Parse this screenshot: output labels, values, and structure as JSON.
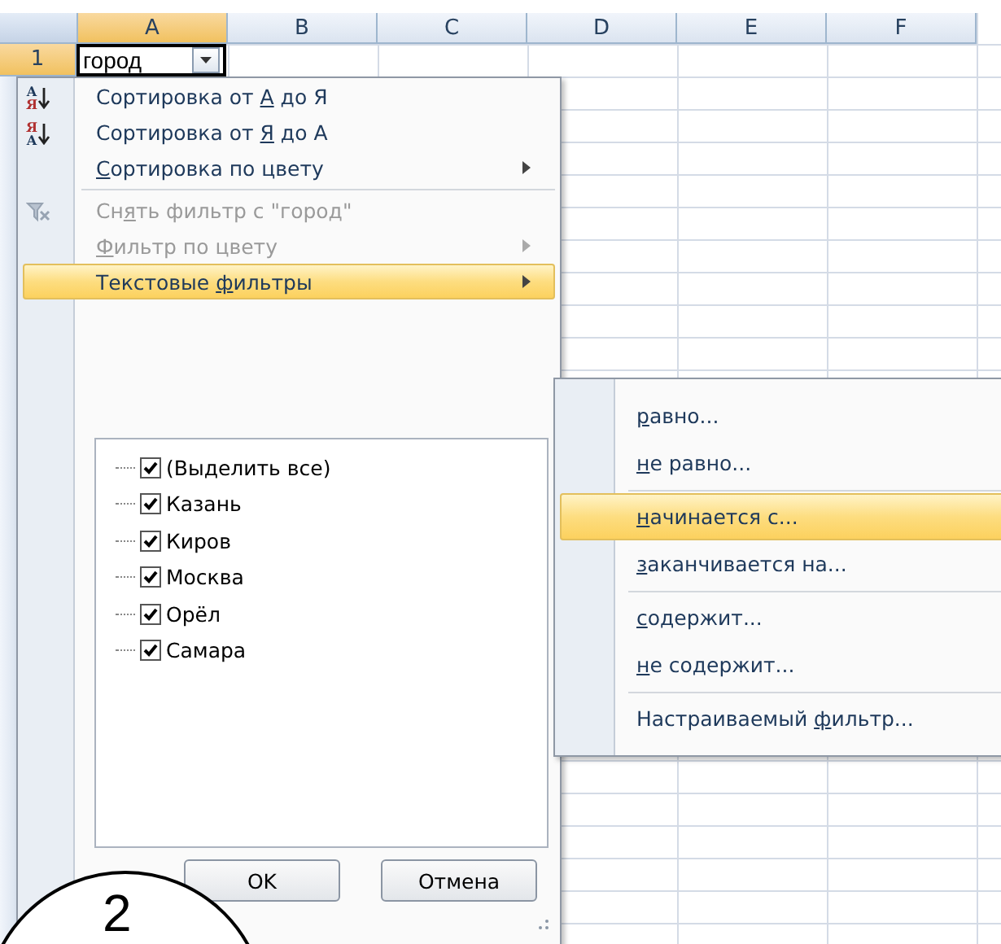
{
  "sheet": {
    "columns": [
      {
        "label": "A",
        "selected": true
      },
      {
        "label": "B",
        "selected": false
      },
      {
        "label": "C",
        "selected": false
      },
      {
        "label": "D",
        "selected": false
      },
      {
        "label": "E",
        "selected": false
      },
      {
        "label": "F",
        "selected": false
      }
    ],
    "rows": [
      {
        "number": "1",
        "selected": true,
        "cell": "город"
      }
    ]
  },
  "filter_menu": {
    "items": [
      {
        "kind": "sort_asc",
        "icon_text": [
          "А",
          "Я"
        ],
        "before": "Сортировка от ",
        "key": "А",
        "after": " до Я",
        "disabled": false,
        "submenu": false,
        "highlighted": false
      },
      {
        "kind": "sort_desc",
        "icon_text": [
          "Я",
          "А"
        ],
        "before": "Сортировка от ",
        "key": "Я",
        "after": " до А",
        "disabled": false,
        "submenu": false,
        "highlighted": false
      },
      {
        "kind": "item",
        "key": "С",
        "after": "ортировка по цвету",
        "disabled": false,
        "submenu": true,
        "highlighted": false
      },
      {
        "kind": "separator"
      },
      {
        "kind": "clear_filter",
        "before": "Сн",
        "key": "я",
        "after": "ть фильтр с \"город\"",
        "disabled": true,
        "submenu": false,
        "highlighted": false
      },
      {
        "kind": "item",
        "key": "Ф",
        "after": "ильтр по цвету",
        "disabled": true,
        "submenu": true,
        "highlighted": false
      },
      {
        "kind": "item",
        "before": "Текстовые ",
        "key": "ф",
        "after": "ильтры",
        "disabled": false,
        "submenu": true,
        "highlighted": true
      }
    ],
    "values": [
      {
        "label": "(Выделить все)",
        "checked": true
      },
      {
        "label": "Казань",
        "checked": true
      },
      {
        "label": "Киров",
        "checked": true
      },
      {
        "label": "Москва",
        "checked": true
      },
      {
        "label": "Орёл",
        "checked": true
      },
      {
        "label": "Самара",
        "checked": true
      }
    ],
    "buttons": [
      "OK",
      "Отмена"
    ]
  },
  "text_filters_menu": {
    "items": [
      {
        "kind": "item",
        "key": "р",
        "after": "авно...",
        "highlighted": false
      },
      {
        "kind": "item",
        "key": "н",
        "after": "е равно...",
        "highlighted": false
      },
      {
        "kind": "separator"
      },
      {
        "kind": "item",
        "key": "н",
        "after": "ачинается с...",
        "highlighted": true
      },
      {
        "kind": "item",
        "key": "з",
        "after": "аканчивается на...",
        "highlighted": false
      },
      {
        "kind": "separator"
      },
      {
        "kind": "item",
        "key": "с",
        "after": "одержит...",
        "highlighted": false
      },
      {
        "kind": "item",
        "key": "н",
        "after": "е содержит...",
        "highlighted": false
      },
      {
        "kind": "separator"
      },
      {
        "kind": "item",
        "before": "Настраиваемый ",
        "key": "ф",
        "after": "ильтр...",
        "highlighted": false
      }
    ]
  },
  "annotation": {
    "text": "2"
  }
}
